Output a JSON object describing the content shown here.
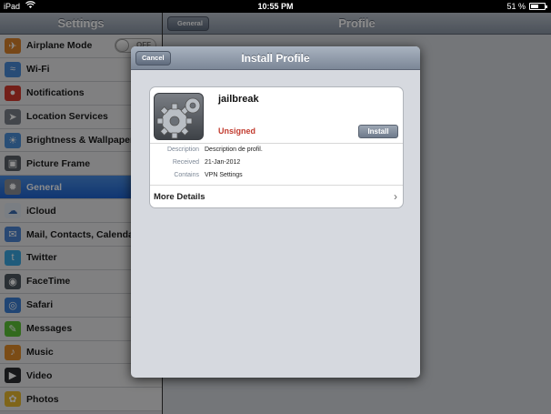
{
  "status_bar": {
    "carrier": "iPad",
    "wifi_icon": "wifi-icon",
    "time": "10:55 PM",
    "battery_percent": "51 %",
    "battery_level": 0.51
  },
  "left": {
    "title": "Settings",
    "items": [
      {
        "label": "Airplane Mode",
        "icon": "airplane-icon",
        "color": "#d9822b",
        "toggle_text": "OFF"
      },
      {
        "label": "Wi-Fi",
        "icon": "wifi-icon",
        "color": "#4a8ad8",
        "value": "Wi"
      },
      {
        "label": "Notifications",
        "icon": "notifications-icon",
        "color": "#d13a2f"
      },
      {
        "label": "Location Services",
        "icon": "location-icon",
        "color": "#7a8089"
      },
      {
        "label": "Brightness & Wallpaper",
        "icon": "brightness-icon",
        "color": "#4b8fd8"
      },
      {
        "label": "Picture Frame",
        "icon": "picture-frame-icon",
        "color": "#5a5f66"
      },
      {
        "label": "General",
        "icon": "gear-icon",
        "color": "#8a8f96",
        "selected": true
      },
      {
        "label": "iCloud",
        "icon": "icloud-icon",
        "color": "#dfe6ef"
      },
      {
        "label": "Mail, Contacts, Calendars",
        "icon": "mail-icon",
        "color": "#4b84d1"
      },
      {
        "label": "Twitter",
        "icon": "twitter-icon",
        "color": "#3aa6e0"
      },
      {
        "label": "FaceTime",
        "icon": "facetime-icon",
        "color": "#4e5660"
      },
      {
        "label": "Safari",
        "icon": "safari-icon",
        "color": "#3b7fd4"
      },
      {
        "label": "Messages",
        "icon": "messages-icon",
        "color": "#5bc236"
      },
      {
        "label": "Music",
        "icon": "music-icon",
        "color": "#e08a28"
      },
      {
        "label": "Video",
        "icon": "video-icon",
        "color": "#2a2d31"
      },
      {
        "label": "Photos",
        "icon": "photos-icon",
        "color": "#e7b92f"
      }
    ]
  },
  "right": {
    "back_label": "General",
    "title": "Profile"
  },
  "modal": {
    "cancel_label": "Cancel",
    "title": "Install Profile",
    "profile_name": "jailbreak",
    "signed_status": "Unsigned",
    "install_label": "Install",
    "details": [
      {
        "key": "Description",
        "value": "Description de profil."
      },
      {
        "key": "Received",
        "value": "21-Jan-2012"
      },
      {
        "key": "Contains",
        "value": "VPN Settings"
      }
    ],
    "more_details_label": "More Details"
  }
}
